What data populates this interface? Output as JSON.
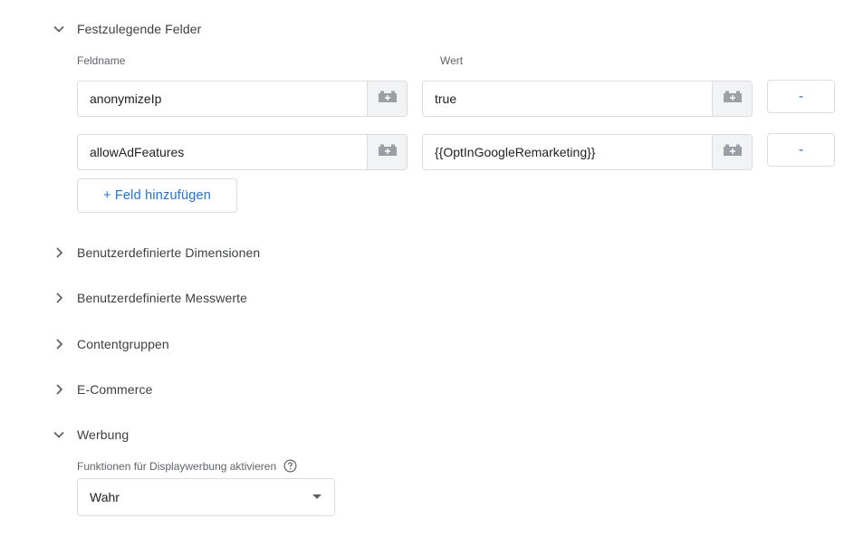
{
  "sections": {
    "fields": {
      "title": "Festzulegende Felder",
      "expanded": true
    },
    "custom_dimensions": {
      "title": "Benutzerdefinierte Dimensionen",
      "expanded": false
    },
    "custom_metrics": {
      "title": "Benutzerdefinierte Messwerte",
      "expanded": false
    },
    "content_groups": {
      "title": "Contentgruppen",
      "expanded": false
    },
    "ecommerce": {
      "title": "E-Commerce",
      "expanded": false
    },
    "advertising": {
      "title": "Werbung",
      "expanded": true
    }
  },
  "fields_table": {
    "col_name": "Feldname",
    "col_value": "Wert",
    "rows": [
      {
        "name": "anonymizeIp",
        "value": "true",
        "remove_label": "-"
      },
      {
        "name": "allowAdFeatures",
        "value": "{{OptInGoogleRemarketing}}",
        "remove_label": "-"
      }
    ],
    "add_label": "+ Feld hinzufügen"
  },
  "advertising": {
    "display_features_label": "Funktionen für Displaywerbung aktivieren",
    "display_features_value": "Wahr"
  },
  "colors": {
    "accent": "#1a73e8",
    "border": "#dadce0",
    "text_secondary": "#5f6368"
  }
}
